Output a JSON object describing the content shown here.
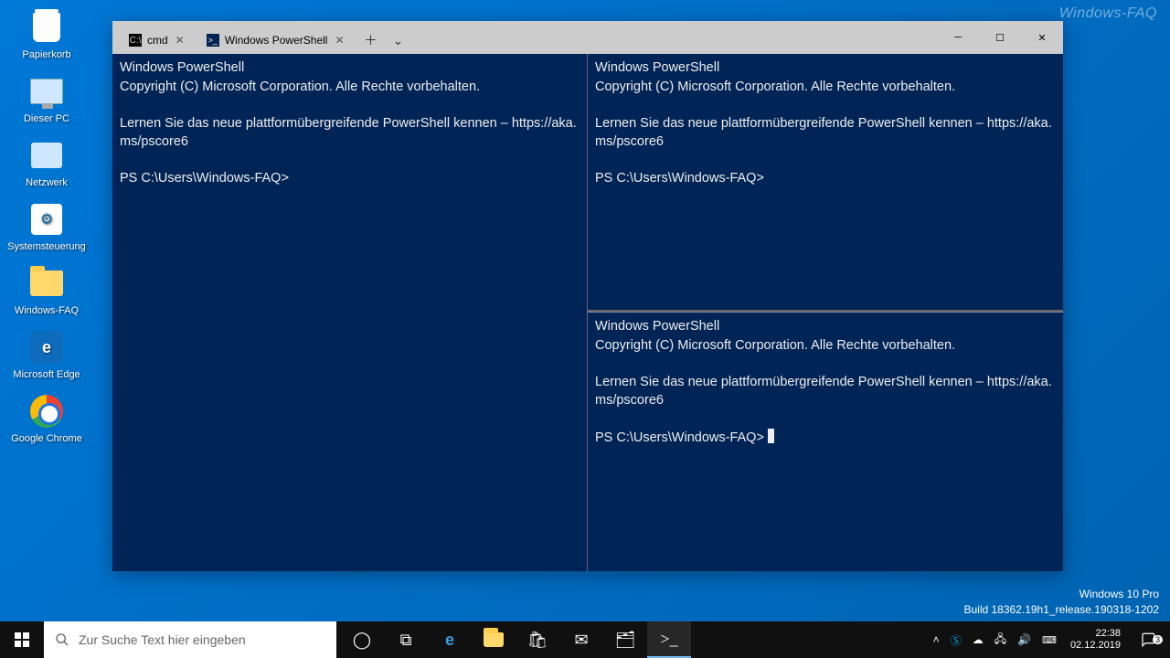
{
  "desktop_icons": [
    {
      "label": "Papierkorb"
    },
    {
      "label": "Dieser PC"
    },
    {
      "label": "Netzwerk"
    },
    {
      "label": "Systemsteuerung"
    },
    {
      "label": "Windows-FAQ"
    },
    {
      "label": "Microsoft Edge"
    },
    {
      "label": "Google Chrome"
    }
  ],
  "window": {
    "tab1_label": "cmd",
    "tab2_label": "Windows PowerShell"
  },
  "terminal": {
    "title": "Windows PowerShell",
    "copyright": "Copyright (C) Microsoft Corporation. Alle Rechte vorbehalten.",
    "learn": "Lernen Sie das neue plattformübergreifende PowerShell kennen – https://aka.ms/pscore6",
    "prompt": "PS C:\\Users\\Windows-FAQ>"
  },
  "watermark": {
    "top": "Windows-FAQ",
    "line1": "Windows 10 Pro",
    "line2": "Build 18362.19h1_release.190318-1202"
  },
  "taskbar": {
    "search_placeholder": "Zur Suche Text hier eingeben"
  },
  "clock": {
    "time": "22:38",
    "date": "02.12.2019"
  },
  "tray_badge": "3"
}
